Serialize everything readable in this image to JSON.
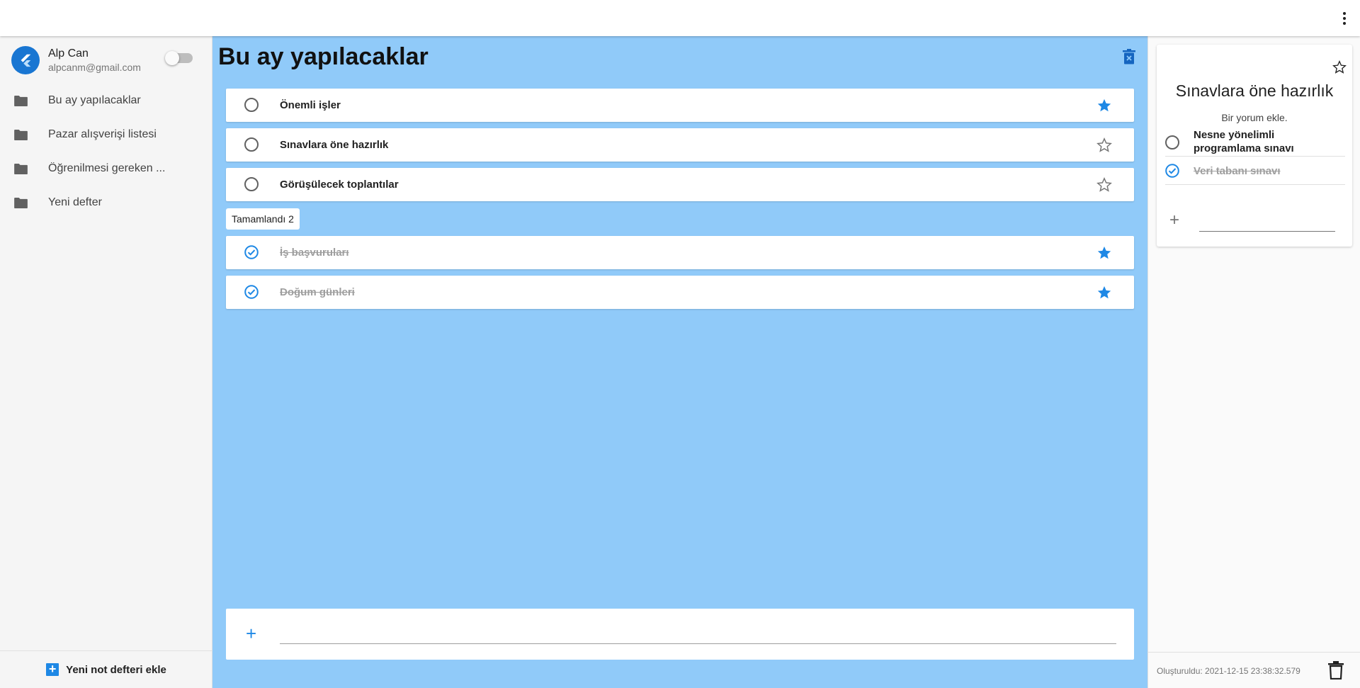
{
  "user": {
    "name": "Alp Can",
    "email": "alpcanm@gmail.com"
  },
  "sidebar": {
    "items": [
      {
        "label": "Bu ay yapılacaklar",
        "icon": "folder-icon"
      },
      {
        "label": "Pazar alışverişi listesi",
        "icon": "folder-icon"
      },
      {
        "label": "Öğrenilmesi gereken ...",
        "icon": "folder-icon"
      },
      {
        "label": "Yeni defter",
        "icon": "folder-icon"
      }
    ],
    "add_label": "Yeni not defteri ekle"
  },
  "main": {
    "title": "Bu ay yapılacaklar",
    "tasks": [
      {
        "label": "Önemli işler",
        "starred": true,
        "done": false
      },
      {
        "label": "Sınavlara öne hazırlık",
        "starred": false,
        "done": false
      },
      {
        "label": "Görüşülecek toplantılar",
        "starred": false,
        "done": false
      }
    ],
    "completed_label": "Tamamlandı 2",
    "completed": [
      {
        "label": "İş başvuruları",
        "starred": true,
        "done": true
      },
      {
        "label": "Doğum günleri",
        "starred": true,
        "done": true
      }
    ]
  },
  "detail": {
    "title": "Sınavlara öne hazırlık",
    "comment_placeholder": "Bir yorum ekle.",
    "subtasks": [
      {
        "label": "Nesne yönelimli programlama sınavı",
        "done": false
      },
      {
        "label": "Veri tabanı sınavı",
        "done": true
      }
    ],
    "created": "Oluşturuldu: 2021-12-15 23:38:32.579"
  },
  "colors": {
    "accent": "#1e88e5",
    "main_bg": "#90caf9",
    "sidebar_bg": "#f5f5f5"
  }
}
